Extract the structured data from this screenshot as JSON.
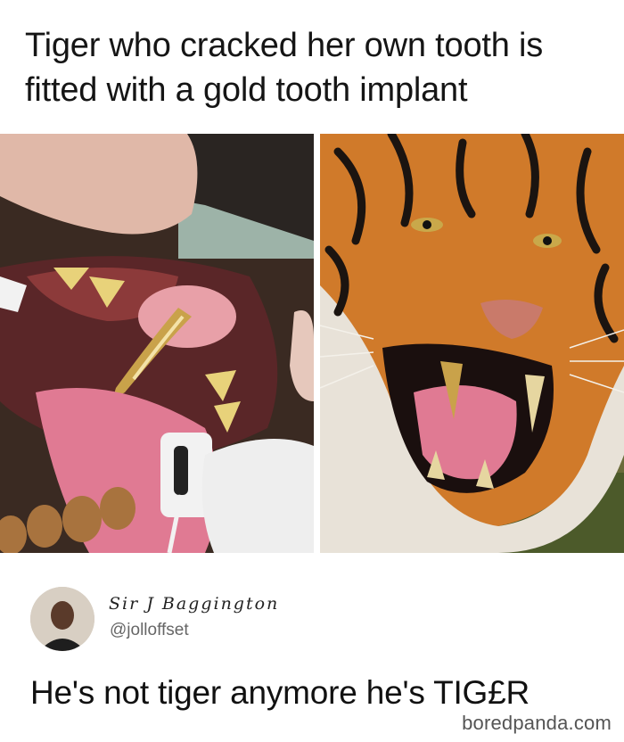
{
  "headline": "Tiger who cracked her own tooth is fitted with a gold tooth implant",
  "tweet": {
    "display_name": "Sir J Baggington",
    "handle": "@jolloffset",
    "text": "He's not tiger anymore he's TIG£R"
  },
  "watermark": "boredpanda.com",
  "colors": {
    "gold": "#c9a24a",
    "tiger_orange": "#d07a2a",
    "tongue_pink": "#e07a93"
  }
}
